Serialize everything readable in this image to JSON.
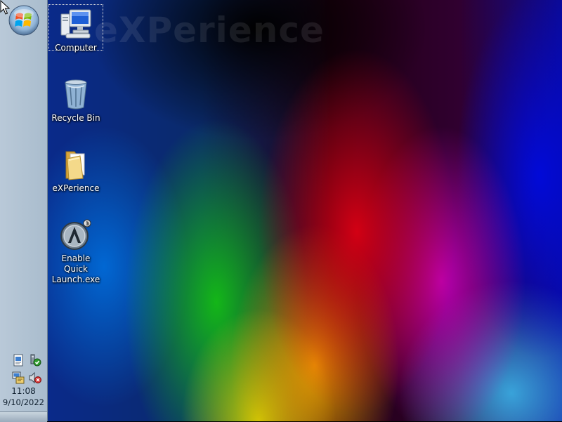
{
  "desktop": {
    "watermark": "eXPerience",
    "icons": [
      {
        "label": "Computer",
        "icon": "computer-icon",
        "selected": true
      },
      {
        "label": "Recycle Bin",
        "icon": "recycle-bin-icon"
      },
      {
        "label": "eXPerience",
        "icon": "folder-icon"
      },
      {
        "label": "Enable Quick Launch.exe",
        "icon": "quick-launch-app-icon"
      }
    ]
  },
  "taskbar": {
    "orientation": "vertical",
    "start_button": {
      "icon": "windows-start-orb-icon"
    },
    "tray_icons": [
      "document-icon",
      "network-check-icon",
      "network-update-icon",
      "volume-muted-icon"
    ],
    "clock": {
      "time": "11:08",
      "date": "9/10/2022"
    }
  },
  "colors": {
    "taskbar_bg": "#b1c3d3",
    "desktop_text": "#ffffff",
    "clock_text": "#10202f"
  }
}
